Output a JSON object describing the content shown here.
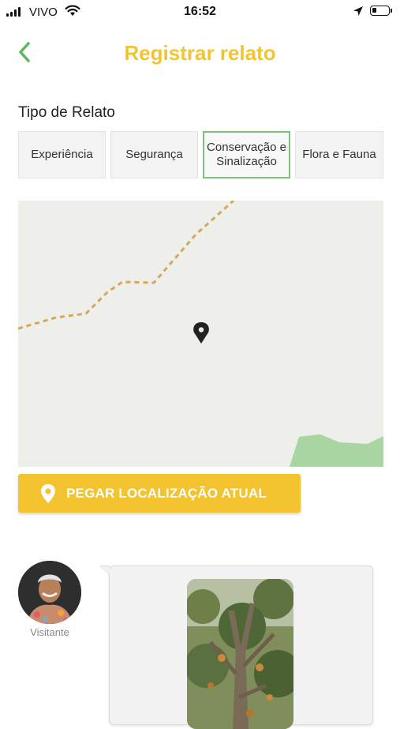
{
  "status_bar": {
    "carrier": "VIVO",
    "time": "16:52"
  },
  "header": {
    "title": "Registrar relato",
    "back_icon": "chevron-left-icon",
    "accent_color": "#f2c530",
    "back_color": "#5cb85c"
  },
  "report_type": {
    "label": "Tipo de Relato",
    "options": [
      {
        "label": "Experiência",
        "selected": false
      },
      {
        "label": "Segurança",
        "selected": false
      },
      {
        "label": "Conservação e Sinalização",
        "selected": true
      },
      {
        "label": "Flora e Fauna",
        "selected": false
      }
    ],
    "selected_border_color": "#7cc27c"
  },
  "map": {
    "marker_icon": "map-pin-icon",
    "trail_color": "#d4a85a",
    "land_color": "#eeeeea",
    "vegetation_color": "#a8d5a2"
  },
  "location_button": {
    "label": "PEGAR LOCALIZAÇÃO ATUAL",
    "icon": "location-pin-icon",
    "color": "#f4c430"
  },
  "report_entry": {
    "user_role": "Visitante",
    "avatar_icon": "avatar"
  }
}
